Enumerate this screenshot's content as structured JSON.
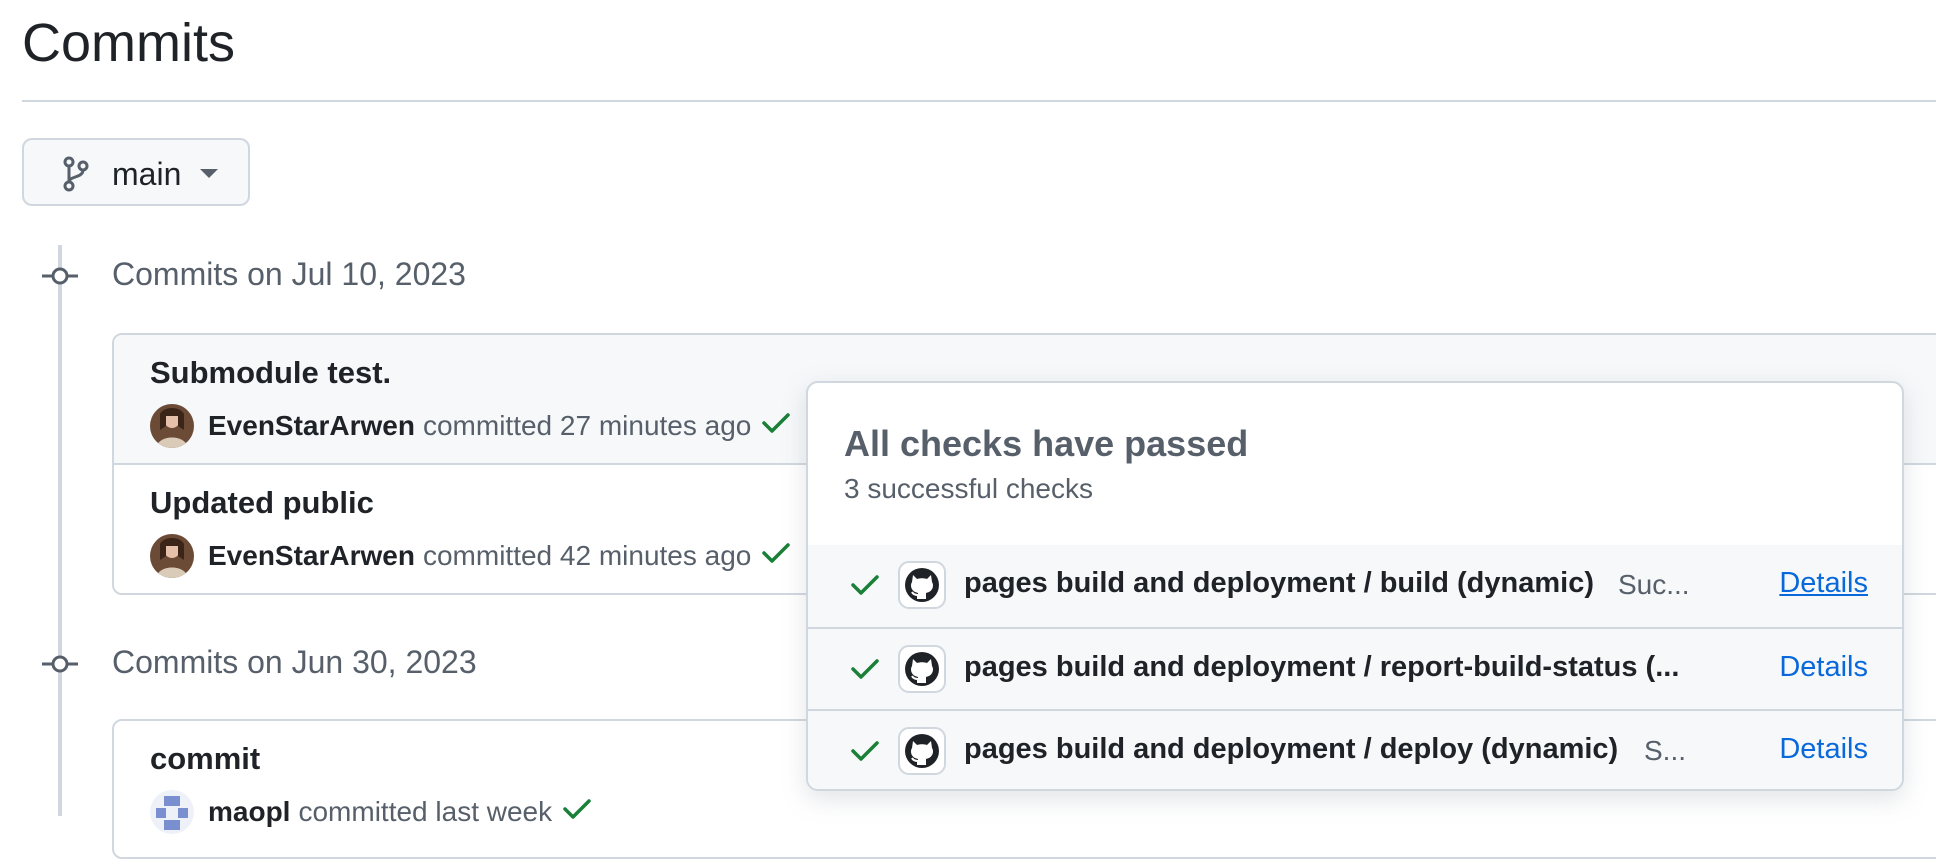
{
  "page": {
    "title": "Commits"
  },
  "branch": {
    "name": "main"
  },
  "groups": [
    {
      "date_heading": "Commits on Jul 10, 2023",
      "commits": [
        {
          "message": "Submodule test.",
          "author": "EvenStarArwen",
          "action": "committed",
          "time": "27 minutes ago"
        },
        {
          "message": "Updated public",
          "author": "EvenStarArwen",
          "action": "committed",
          "time": "42 minutes ago"
        }
      ]
    },
    {
      "date_heading": "Commits on Jun 30, 2023",
      "commits": [
        {
          "message": "commit",
          "author": "maopl",
          "action": "committed",
          "time": "last week"
        }
      ]
    }
  ],
  "checks_popover": {
    "title": "All checks have passed",
    "subtitle": "3 successful checks",
    "checks": [
      {
        "name": "pages build and deployment / build (dynamic)",
        "status": "Suc...",
        "link": "Details"
      },
      {
        "name": "pages build and deployment / report-build-status (...",
        "status": "",
        "link": "Details"
      },
      {
        "name": "pages build and deployment / deploy (dynamic)",
        "status": "S...",
        "link": "Details"
      }
    ]
  },
  "icons": {
    "branch": "git-branch-icon",
    "caret": "triangle-down-icon",
    "commit_node": "git-commit-icon",
    "success": "check-icon",
    "github": "github-mark-icon"
  },
  "colors": {
    "success": "#1a7f37",
    "link": "#0969da",
    "border": "#d0d7de",
    "muted_text": "#57606a",
    "row_bg": "#f6f8fa"
  }
}
